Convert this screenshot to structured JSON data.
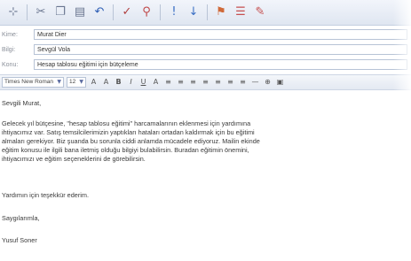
{
  "toolbar": {
    "buttons": [
      {
        "name": "pin-icon",
        "glyph": "⊹"
      },
      {
        "name": "cut-icon",
        "glyph": "✂"
      },
      {
        "name": "copy-icon",
        "glyph": "❐"
      },
      {
        "name": "paste-icon",
        "glyph": "▤"
      },
      {
        "name": "undo-icon",
        "glyph": "↶"
      },
      {
        "name": "spellcheck-icon",
        "glyph": "✓"
      },
      {
        "name": "attach-icon",
        "glyph": "⚲"
      },
      {
        "name": "priority-high-icon",
        "glyph": "!"
      },
      {
        "name": "priority-low-icon",
        "glyph": "↓"
      },
      {
        "name": "flag-icon",
        "glyph": "⚑"
      },
      {
        "name": "options-icon",
        "glyph": "☰"
      },
      {
        "name": "signature-icon",
        "glyph": "✎"
      }
    ]
  },
  "header": {
    "to": {
      "label": "Kime:",
      "value": "Murat Dier"
    },
    "cc": {
      "label": "Bilgi:",
      "value": "Sevgül Vola"
    },
    "subject": {
      "label": "Konu:",
      "value": "Hesap tablosu eğitimi için bütçeleme"
    }
  },
  "format": {
    "font": "Times New Roman",
    "size": "12",
    "buttons": [
      "A",
      "A",
      "B",
      "I",
      "U",
      "A",
      "≡",
      "≡",
      "≡",
      "≡",
      "≡",
      "≡",
      "≡",
      "—",
      "⊕",
      "▣"
    ]
  },
  "body": {
    "lines": [
      "Sevgili Murat,",
      "",
      "Gelecek yıl bütçesine, \"hesap tablosu eğitimi\" harcamalarının eklenmesi için yardımına",
      "ihtiyacımız var. Satış temsilcilerimizin yaptıkları hataları ortadan kaldırmak için bu eğitimi",
      "almaları gerekiyor. Biz şuanda bu sorunla ciddi anlamda mücadele ediyoruz. Mailin ekinde",
      "eğitim konusu ile ilgili bana iletmiş olduğu bilgiyi bulabilirsin. Buradan eğitimin önemini,",
      "ihtiyacımızı ve eğitim seçeneklerini de görebilirsin.",
      "",
      "Yardımın için teşekkür ederim.",
      "",
      "Saygılarımla,",
      "",
      "Yusuf Soner"
    ]
  }
}
